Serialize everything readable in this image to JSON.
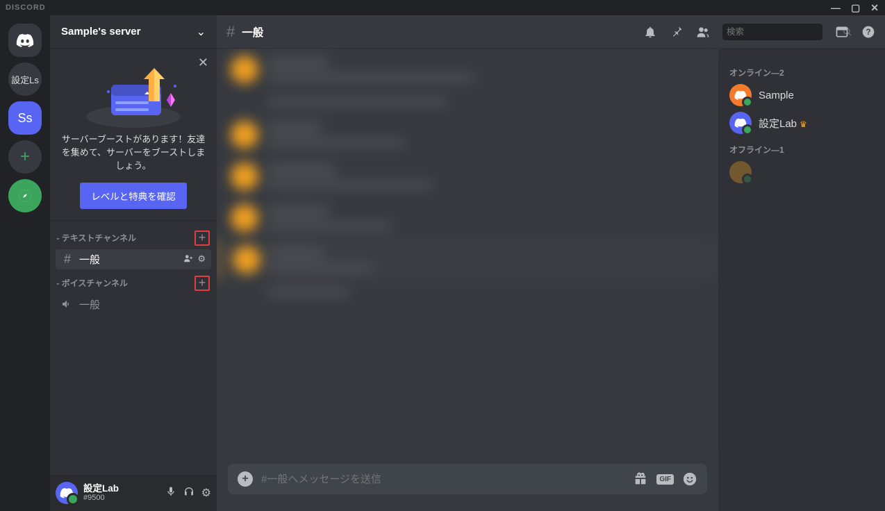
{
  "app": {
    "brand": "DISCORD"
  },
  "guilds": {
    "label1": "設定Ls",
    "label2": "Ss"
  },
  "sidebar": {
    "server_name": "Sample's server",
    "boost_text": "サーバーブーストがあります！友達を集めて、サーバーをブーストしましょう。",
    "boost_button": "レベルと特典を確認",
    "text_category": "テキストチャンネル",
    "voice_category": "ボイスチャンネル",
    "text_channel": "一般",
    "voice_channel": "一般"
  },
  "user": {
    "name": "設定Lab",
    "tag": "#9500"
  },
  "topbar": {
    "channel": "一般"
  },
  "search": {
    "placeholder": "検索"
  },
  "composer": {
    "placeholder": "#一般へメッセージを送信",
    "gif": "GIF"
  },
  "members": {
    "online_header": "オンライン—2",
    "offline_header": "オフライン—1",
    "m1": "Sample",
    "m2": "設定Lab"
  }
}
